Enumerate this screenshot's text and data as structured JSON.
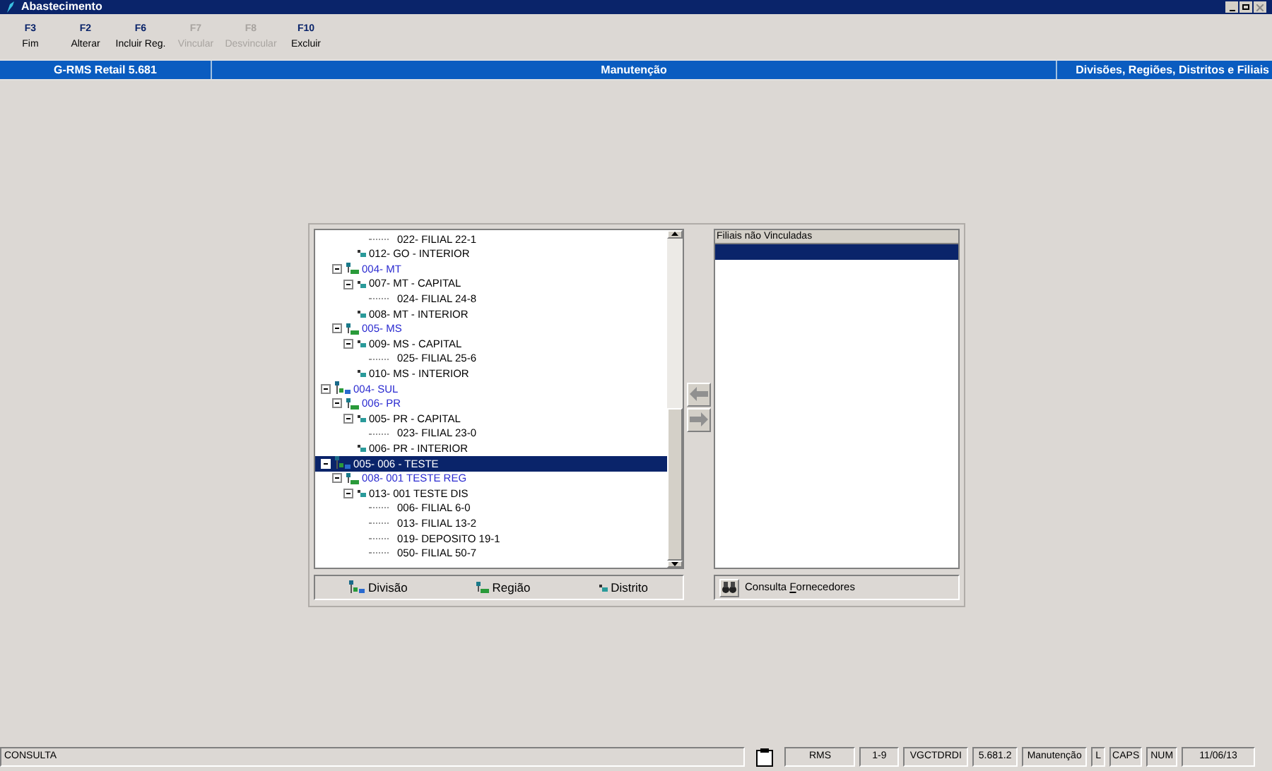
{
  "window": {
    "title": "Abastecimento"
  },
  "toolbar": [
    {
      "key": "F3",
      "label": "Fim",
      "disabled": false
    },
    {
      "key": "F2",
      "label": "Alterar",
      "disabled": false
    },
    {
      "key": "F6",
      "label": "Incluir Reg.",
      "disabled": false
    },
    {
      "key": "F7",
      "label": "Vincular",
      "disabled": true
    },
    {
      "key": "F8",
      "label": "Desvincular",
      "disabled": true
    },
    {
      "key": "F10",
      "label": "Excluir",
      "disabled": false
    }
  ],
  "header_bar": {
    "product": "G-RMS Retail 5.681",
    "mode": "Manutenção",
    "screen": "Divisões, Regiões, Distritos e Filiais"
  },
  "tree": {
    "items": [
      {
        "children": [
          {
            "children": [
              {
                "children": [
                  {
                    "label": "022- FILIAL 22-1",
                    "kind": "filial",
                    "selected": false
                  }
                ]
              },
              {
                "label": "012- GO - INTERIOR",
                "kind": "district",
                "selected": false
              }
            ]
          },
          {
            "label": "004- MT",
            "kind": "region",
            "expanded": true,
            "selected": false,
            "children": [
              {
                "label": "007- MT - CAPITAL",
                "kind": "district",
                "expanded": true,
                "selected": false,
                "children": [
                  {
                    "label": "024- FILIAL 24-8",
                    "kind": "filial",
                    "selected": false
                  }
                ]
              },
              {
                "label": "008- MT - INTERIOR",
                "kind": "district",
                "selected": false
              }
            ]
          },
          {
            "label": "005- MS",
            "kind": "region",
            "expanded": true,
            "selected": false,
            "children": [
              {
                "label": "009- MS - CAPITAL",
                "kind": "district",
                "expanded": true,
                "selected": false,
                "children": [
                  {
                    "label": "025- FILIAL 25-6",
                    "kind": "filial",
                    "selected": false
                  }
                ]
              },
              {
                "label": "010- MS - INTERIOR",
                "kind": "district",
                "selected": false
              }
            ]
          }
        ]
      },
      {
        "label": "004- SUL",
        "kind": "division",
        "expanded": true,
        "selected": false,
        "children": [
          {
            "label": "006- PR",
            "kind": "region",
            "expanded": true,
            "selected": false,
            "children": [
              {
                "label": "005- PR - CAPITAL",
                "kind": "district",
                "expanded": true,
                "selected": false,
                "children": [
                  {
                    "label": "023- FILIAL 23-0",
                    "kind": "filial",
                    "selected": false
                  }
                ]
              },
              {
                "label": "006- PR - INTERIOR",
                "kind": "district",
                "selected": false
              }
            ]
          }
        ]
      },
      {
        "label": "005- 006 - TESTE",
        "kind": "division",
        "expanded": true,
        "selected": true,
        "children": [
          {
            "label": "008- 001 TESTE REG",
            "kind": "region",
            "expanded": true,
            "selected": false,
            "children": [
              {
                "label": "013- 001 TESTE DIS",
                "kind": "district",
                "expanded": true,
                "selected": false,
                "children": [
                  {
                    "label": "006- FILIAL 6-0",
                    "kind": "filial",
                    "selected": false
                  },
                  {
                    "label": "013- FILIAL 13-2",
                    "kind": "filial",
                    "selected": false
                  },
                  {
                    "label": "019- DEPOSITO 19-1",
                    "kind": "filial",
                    "selected": false
                  },
                  {
                    "label": "050- FILIAL 50-7",
                    "kind": "filial",
                    "selected": false
                  }
                ]
              }
            ]
          }
        ]
      }
    ]
  },
  "tree_buttons": [
    {
      "label": "Divisão",
      "kind": "division"
    },
    {
      "label": "Região",
      "kind": "region"
    },
    {
      "label": "Distrito",
      "kind": "district"
    }
  ],
  "unlinked_list": {
    "header": "Filiais não Vinculadas",
    "rows": [
      {
        "selected": true
      }
    ]
  },
  "supplier_button": {
    "label_prefix": "Consulta ",
    "label_hotkey": "F",
    "label_rest": "ornecedores"
  },
  "status_bar": {
    "mode": "CONSULTA",
    "cells": [
      "RMS",
      "1-9",
      "VGCTDRDI",
      "5.681.2",
      "Manutenção",
      "L",
      "CAPS",
      "NUM",
      "11/06/13"
    ]
  }
}
